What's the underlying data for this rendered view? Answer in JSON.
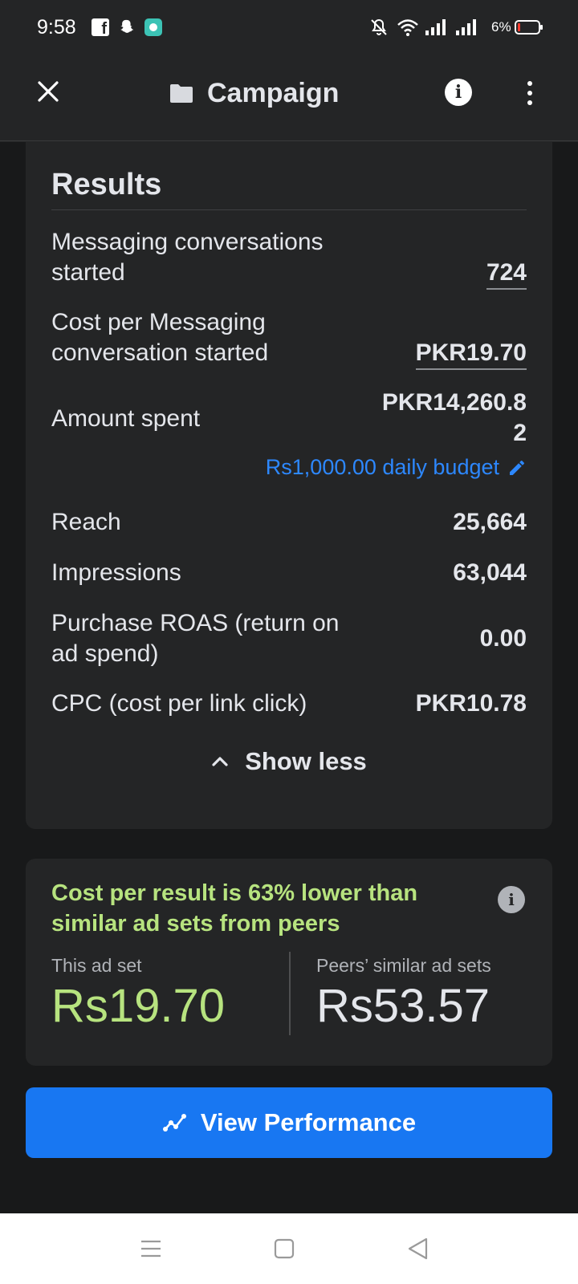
{
  "status_bar": {
    "time": "9:58",
    "battery_percent": "6%",
    "apps": [
      "facebook-icon",
      "snapchat-icon",
      "ring-app-icon"
    ]
  },
  "header": {
    "title": "Campaign",
    "icons": [
      "close-icon",
      "folder-icon",
      "info-icon",
      "more-vertical-icon"
    ]
  },
  "results": {
    "title": "Results",
    "metrics": [
      {
        "label": "Messaging conversations started",
        "value": "724"
      },
      {
        "label": "Cost per Messaging conversation started",
        "value": "PKR19.70"
      },
      {
        "label": "Amount spent",
        "value": "PKR14,260.82"
      },
      {
        "label": "Reach",
        "value": "25,664"
      },
      {
        "label": "Impressions",
        "value": "63,044"
      },
      {
        "label": "Purchase ROAS (return on ad spend)",
        "value": "0.00"
      },
      {
        "label": "CPC (cost per link click)",
        "value": "PKR10.78"
      }
    ],
    "budget_link": "Rs1,000.00 daily budget",
    "show_less": "Show less"
  },
  "peers": {
    "headline": "Cost per result is 63% lower than similar ad sets from peers",
    "this_label": "This ad set",
    "this_value": "Rs19.70",
    "peers_label": "Peers’ similar ad sets",
    "peers_value": "Rs53.57"
  },
  "view_button": {
    "label": "View Performance"
  },
  "colors": {
    "accent": "#1877f2",
    "link": "#2d88ff",
    "positive": "#b7e37f",
    "background": "#18191a",
    "card": "#242526"
  }
}
